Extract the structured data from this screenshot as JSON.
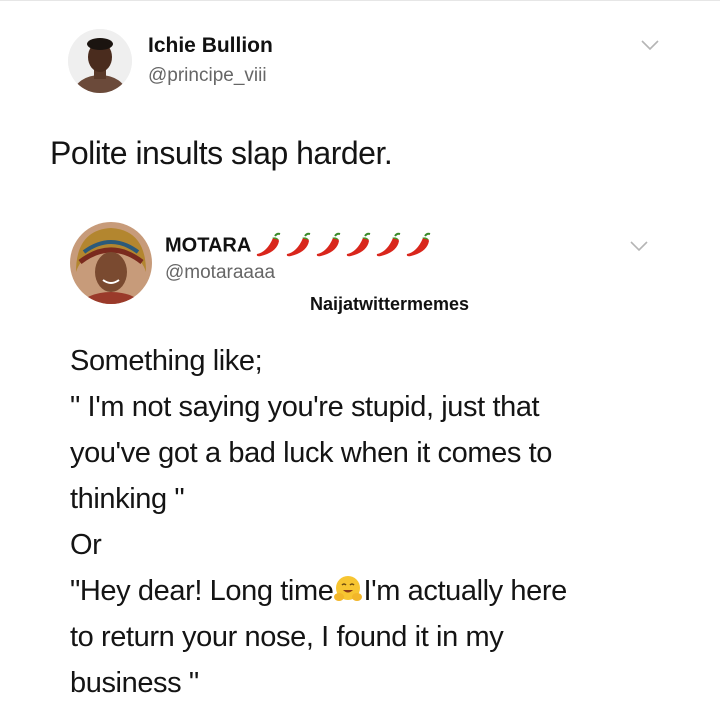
{
  "tweet1": {
    "name": "Ichie Bullion",
    "handle": "@principe_viii",
    "text": "Polite insults slap harder."
  },
  "tweet2": {
    "name": "MOTARA",
    "handle": "@motaraaaa",
    "watermark": "Naijatwittermemes",
    "name_icon": "chili-pepper-emoji",
    "inline_icon": "hugging-face-emoji",
    "lines": [
      "Something like;",
      "\" I'm not saying you're stupid, just that",
      "you've got a bad luck when it comes to",
      "thinking \"",
      "Or",
      "\"Hey dear! Long time",
      "I'm actually here",
      "to return your nose, I found it in my",
      "business \""
    ]
  }
}
